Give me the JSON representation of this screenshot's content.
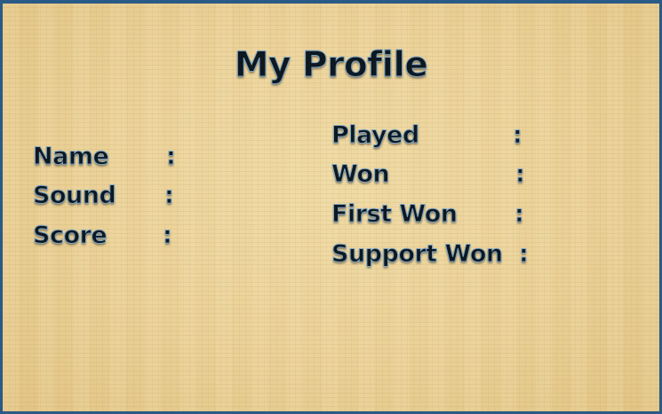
{
  "title": "My Profile",
  "left_fields": [
    {
      "label": "Name",
      "separator": ":"
    },
    {
      "label": "Sound",
      "separator": ":"
    },
    {
      "label": "Score",
      "separator": ":"
    }
  ],
  "right_fields": [
    {
      "label": "Played",
      "separator": ":"
    },
    {
      "label": "Won",
      "separator": ":"
    },
    {
      "label": "First Won",
      "separator": ":"
    },
    {
      "label": "Support Won",
      "separator": ":"
    }
  ],
  "colors": {
    "frame_border": "#2a5a86",
    "parchment": "#f1dca4",
    "text": "#0e1820",
    "text_outline": "#7fa6c4"
  }
}
